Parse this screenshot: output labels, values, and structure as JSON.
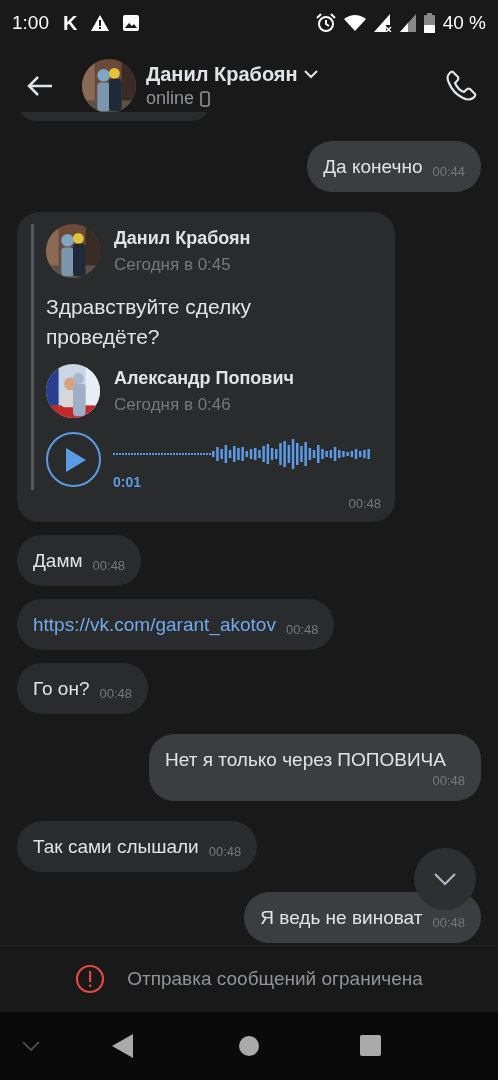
{
  "status_bar": {
    "time": "1:00",
    "app_letter": "K",
    "battery": "40 %"
  },
  "header": {
    "name": "Данил Крабоян",
    "status": "online"
  },
  "messages": [
    {
      "kind": "partial",
      "outgoing": false
    },
    {
      "kind": "text",
      "outgoing": true,
      "text": "Да конечно",
      "time": "00:44"
    },
    {
      "kind": "forward",
      "outgoing": false,
      "author": "Данил Крабоян",
      "date": "Сегодня в 0:45",
      "text": "Здравствуйте сделку проведёте?",
      "voice_author": "Александр Попович",
      "voice_date": "Сегодня в 0:46",
      "duration": "0:01",
      "time": "00:48"
    },
    {
      "kind": "text",
      "outgoing": false,
      "text": "Дамм",
      "time": "00:48"
    },
    {
      "kind": "link",
      "outgoing": false,
      "text": "https://vk.com/garant_akotov",
      "time": "00:48"
    },
    {
      "kind": "text",
      "outgoing": false,
      "text": "Го он?",
      "time": "00:48"
    },
    {
      "kind": "text",
      "outgoing": true,
      "text": "Нет я только через ПОПОВИЧА",
      "time": "00:48"
    },
    {
      "kind": "text",
      "outgoing": false,
      "text": "Так сами слышали",
      "time": "00:48"
    },
    {
      "kind": "text",
      "outgoing": true,
      "text": "Я ведь не виноват",
      "time": "00:48"
    }
  ],
  "notice": "Отправка сообщений ограничена"
}
